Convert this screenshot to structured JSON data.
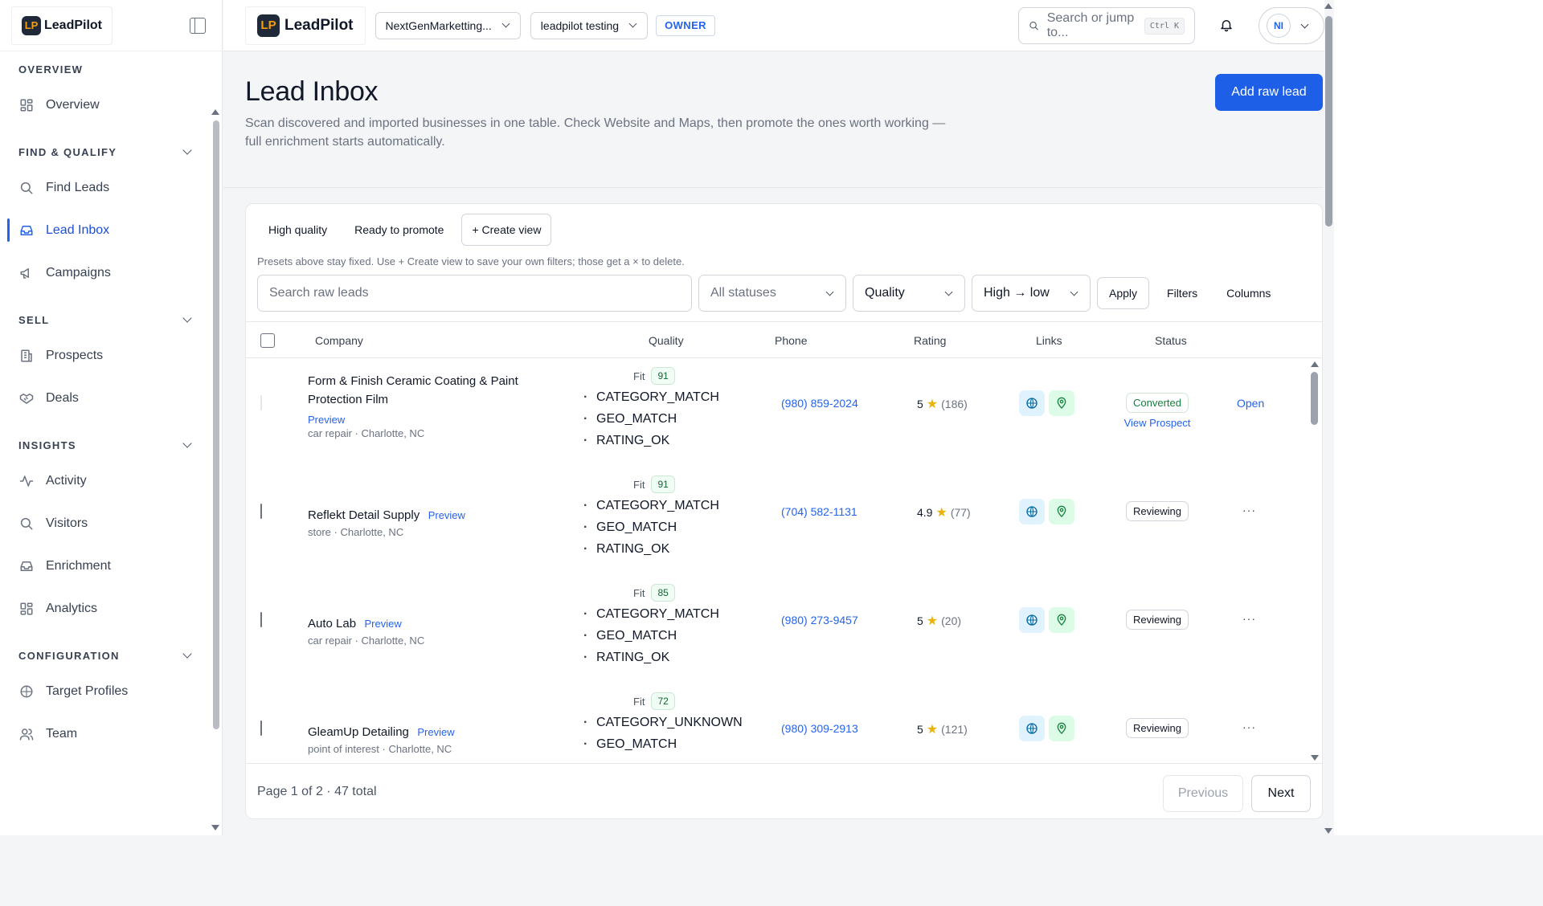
{
  "brand": {
    "name": "LeadPilot",
    "mark": "LP"
  },
  "sidebar": {
    "sections": [
      {
        "title": "OVERVIEW",
        "collapsible": false,
        "items": [
          {
            "label": "Overview",
            "icon": "grid-icon"
          }
        ]
      },
      {
        "title": "FIND & QUALIFY",
        "collapsible": true,
        "items": [
          {
            "label": "Find Leads",
            "icon": "search-icon"
          },
          {
            "label": "Lead Inbox",
            "icon": "inbox-icon",
            "active": true
          },
          {
            "label": "Campaigns",
            "icon": "megaphone-icon"
          }
        ]
      },
      {
        "title": "SELL",
        "collapsible": true,
        "items": [
          {
            "label": "Prospects",
            "icon": "building-icon"
          },
          {
            "label": "Deals",
            "icon": "handshake-icon"
          }
        ]
      },
      {
        "title": "INSIGHTS",
        "collapsible": true,
        "items": [
          {
            "label": "Activity",
            "icon": "activity-icon"
          },
          {
            "label": "Visitors",
            "icon": "search-icon"
          },
          {
            "label": "Enrichment",
            "icon": "inbox-icon"
          },
          {
            "label": "Analytics",
            "icon": "grid-icon"
          }
        ]
      },
      {
        "title": "CONFIGURATION",
        "collapsible": true,
        "items": [
          {
            "label": "Target Profiles",
            "icon": "target-icon"
          },
          {
            "label": "Team",
            "icon": "users-icon"
          }
        ]
      }
    ]
  },
  "topbar": {
    "workspace": "NextGenMarketting...",
    "project": "leadpilot testing",
    "role": "OWNER",
    "search_placeholder": "Search or jump to...",
    "shortcut": "Ctrl K",
    "avatar_initials": "NI"
  },
  "page": {
    "title": "Lead Inbox",
    "subtitle": "Scan discovered and imported businesses in one table. Check Website and Maps, then promote the ones worth working — full enrichment starts automatically.",
    "add_button": "Add raw lead"
  },
  "views": {
    "tabs": [
      "High quality",
      "Ready to promote"
    ],
    "create": "+ Create view",
    "hint": "Presets above stay fixed. Use + Create view to save your own filters; those get a × to delete."
  },
  "filters": {
    "search_placeholder": "Search raw leads",
    "status": "All statuses",
    "sort_field": "Quality",
    "sort_order": "High → low",
    "apply": "Apply",
    "filters": "Filters",
    "columns": "Columns"
  },
  "table": {
    "columns": [
      "Company",
      "Quality",
      "Phone",
      "Rating",
      "Links",
      "Status"
    ],
    "fit_label": "Fit",
    "preview_label": "Preview",
    "rows": [
      {
        "company": "Form & Finish Ceramic Coating & Paint Protection Film",
        "meta": "car repair · Charlotte, NC",
        "fit": "91",
        "reasons": [
          "CATEGORY_MATCH",
          "GEO_MATCH",
          "RATING_OK"
        ],
        "phone": "(980) 859-2024",
        "rating": "5",
        "reviews": "(186)",
        "status": "Converted",
        "status_link": "View Prospect",
        "action": "Open",
        "checkbox_disabled": true
      },
      {
        "company": "Reflekt Detail Supply",
        "meta": "store · Charlotte, NC",
        "fit": "91",
        "reasons": [
          "CATEGORY_MATCH",
          "GEO_MATCH",
          "RATING_OK"
        ],
        "phone": "(704) 582-1131",
        "rating": "4.9",
        "reviews": "(77)",
        "status": "Reviewing",
        "action": "···"
      },
      {
        "company": "Auto Lab",
        "meta": "car repair · Charlotte, NC",
        "fit": "85",
        "reasons": [
          "CATEGORY_MATCH",
          "GEO_MATCH",
          "RATING_OK"
        ],
        "phone": "(980) 273-9457",
        "rating": "5",
        "reviews": "(20)",
        "status": "Reviewing",
        "action": "···"
      },
      {
        "company": "GleamUp Detailing",
        "meta": "point of interest · Charlotte, NC",
        "fit": "72",
        "reasons": [
          "CATEGORY_UNKNOWN",
          "GEO_MATCH"
        ],
        "phone": "(980) 309-2913",
        "rating": "5",
        "reviews": "(121)",
        "status": "Reviewing",
        "action": "···"
      }
    ]
  },
  "pagination": {
    "summary": "Page 1 of 2 · 47 total",
    "previous": "Previous",
    "next": "Next"
  },
  "colors": {
    "accent": "#1d5fe6",
    "star": "#eab308",
    "converted": "#15803d"
  }
}
